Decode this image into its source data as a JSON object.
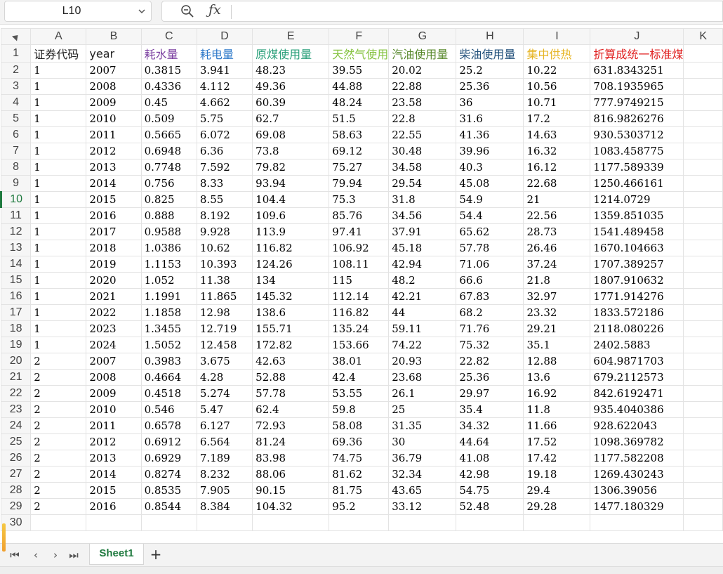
{
  "name_box": {
    "value": "L10"
  },
  "formula": {
    "value": ""
  },
  "column_letters": [
    "A",
    "B",
    "C",
    "D",
    "E",
    "F",
    "G",
    "H",
    "I",
    "J",
    "K"
  ],
  "row_numbers": [
    "1",
    "2",
    "3",
    "4",
    "5",
    "6",
    "7",
    "8",
    "9",
    "10",
    "11",
    "12",
    "13",
    "14",
    "15",
    "16",
    "17",
    "18",
    "19",
    "20",
    "21",
    "22",
    "23",
    "24",
    "25",
    "26",
    "27",
    "28",
    "29",
    "30"
  ],
  "active_row": "10",
  "headers": [
    {
      "text": "证券代码",
      "color": "#222222"
    },
    {
      "text": "year",
      "color": "#222222"
    },
    {
      "text": "耗水量",
      "color": "#7b3fa0"
    },
    {
      "text": "耗电量",
      "color": "#2e79c9"
    },
    {
      "text": "原煤使用量",
      "color": "#2aa07a"
    },
    {
      "text": "天然气使用",
      "color": "#86c341"
    },
    {
      "text": "汽油使用量",
      "color": "#5a8a2e"
    },
    {
      "text": "柴油使用量",
      "color": "#1f4e79"
    },
    {
      "text": "集中供热",
      "color": "#e6b422"
    },
    {
      "text": "折算成统一标准煤",
      "color": "#e02020"
    }
  ],
  "rows": [
    [
      "1",
      "2007",
      "0.3815",
      "3.941",
      "48.23",
      "39.55",
      "20.02",
      "25.2",
      "10.22",
      "631.8343251"
    ],
    [
      "1",
      "2008",
      "0.4336",
      "4.112",
      "49.36",
      "44.88",
      "22.88",
      "25.36",
      "10.56",
      "708.1935965"
    ],
    [
      "1",
      "2009",
      "0.45",
      "4.662",
      "60.39",
      "48.24",
      "23.58",
      "36",
      "10.71",
      "777.9749215"
    ],
    [
      "1",
      "2010",
      "0.509",
      "5.75",
      "62.7",
      "51.5",
      "22.8",
      "31.6",
      "17.2",
      "816.9826276"
    ],
    [
      "1",
      "2011",
      "0.5665",
      "6.072",
      "69.08",
      "58.63",
      "22.55",
      "41.36",
      "14.63",
      "930.5303712"
    ],
    [
      "1",
      "2012",
      "0.6948",
      "6.36",
      "73.8",
      "69.12",
      "30.48",
      "39.96",
      "16.32",
      "1083.458775"
    ],
    [
      "1",
      "2013",
      "0.7748",
      "7.592",
      "79.82",
      "75.27",
      "34.58",
      "40.3",
      "16.12",
      "1177.589339"
    ],
    [
      "1",
      "2014",
      "0.756",
      "8.33",
      "93.94",
      "79.94",
      "29.54",
      "45.08",
      "22.68",
      "1250.466161"
    ],
    [
      "1",
      "2015",
      "0.825",
      "8.55",
      "104.4",
      "75.3",
      "31.8",
      "54.9",
      "21",
      "1214.0729"
    ],
    [
      "1",
      "2016",
      "0.888",
      "8.192",
      "109.6",
      "85.76",
      "34.56",
      "54.4",
      "22.56",
      "1359.851035"
    ],
    [
      "1",
      "2017",
      "0.9588",
      "9.928",
      "113.9",
      "97.41",
      "37.91",
      "65.62",
      "28.73",
      "1541.489458"
    ],
    [
      "1",
      "2018",
      "1.0386",
      "10.62",
      "116.82",
      "106.92",
      "45.18",
      "57.78",
      "26.46",
      "1670.104663"
    ],
    [
      "1",
      "2019",
      "1.1153",
      "10.393",
      "124.26",
      "108.11",
      "42.94",
      "71.06",
      "37.24",
      "1707.389257"
    ],
    [
      "1",
      "2020",
      "1.052",
      "11.38",
      "134",
      "115",
      "48.2",
      "66.6",
      "21.8",
      "1807.910632"
    ],
    [
      "1",
      "2021",
      "1.1991",
      "11.865",
      "145.32",
      "112.14",
      "42.21",
      "67.83",
      "32.97",
      "1771.914276"
    ],
    [
      "1",
      "2022",
      "1.1858",
      "12.98",
      "138.6",
      "116.82",
      "44",
      "68.2",
      "23.32",
      "1833.572186"
    ],
    [
      "1",
      "2023",
      "1.3455",
      "12.719",
      "155.71",
      "135.24",
      "59.11",
      "71.76",
      "29.21",
      "2118.080226"
    ],
    [
      "1",
      "2024",
      "1.5052",
      "12.458",
      "172.82",
      "153.66",
      "74.22",
      "75.32",
      "35.1",
      "2402.5883"
    ],
    [
      "2",
      "2007",
      "0.3983",
      "3.675",
      "42.63",
      "38.01",
      "20.93",
      "22.82",
      "12.88",
      "604.9871703"
    ],
    [
      "2",
      "2008",
      "0.4664",
      "4.28",
      "52.88",
      "42.4",
      "23.68",
      "25.36",
      "13.6",
      "679.2112573"
    ],
    [
      "2",
      "2009",
      "0.4518",
      "5.274",
      "57.78",
      "53.55",
      "26.1",
      "29.97",
      "16.92",
      "842.6192471"
    ],
    [
      "2",
      "2010",
      "0.546",
      "5.47",
      "62.4",
      "59.8",
      "25",
      "35.4",
      "11.8",
      "935.4040386"
    ],
    [
      "2",
      "2011",
      "0.6578",
      "6.127",
      "72.93",
      "58.08",
      "31.35",
      "34.32",
      "11.66",
      "928.622043"
    ],
    [
      "2",
      "2012",
      "0.6912",
      "6.564",
      "81.24",
      "69.36",
      "30",
      "44.64",
      "17.52",
      "1098.369782"
    ],
    [
      "2",
      "2013",
      "0.6929",
      "7.189",
      "83.98",
      "74.75",
      "36.79",
      "41.08",
      "17.42",
      "1177.582208"
    ],
    [
      "2",
      "2014",
      "0.8274",
      "8.232",
      "88.06",
      "81.62",
      "32.34",
      "42.98",
      "19.18",
      "1269.430243"
    ],
    [
      "2",
      "2015",
      "0.8535",
      "7.905",
      "90.15",
      "81.75",
      "43.65",
      "54.75",
      "29.4",
      "1306.39056"
    ],
    [
      "2",
      "2016",
      "0.8544",
      "8.384",
      "104.32",
      "95.2",
      "33.12",
      "52.48",
      "29.28",
      "1477.180329"
    ]
  ],
  "sheet_tabs": [
    {
      "label": "Sheet1",
      "active": true
    }
  ],
  "add_sheet_label": "+",
  "icons": {
    "first": "⏮",
    "prev": "‹",
    "next": "›",
    "last": "⏭"
  }
}
